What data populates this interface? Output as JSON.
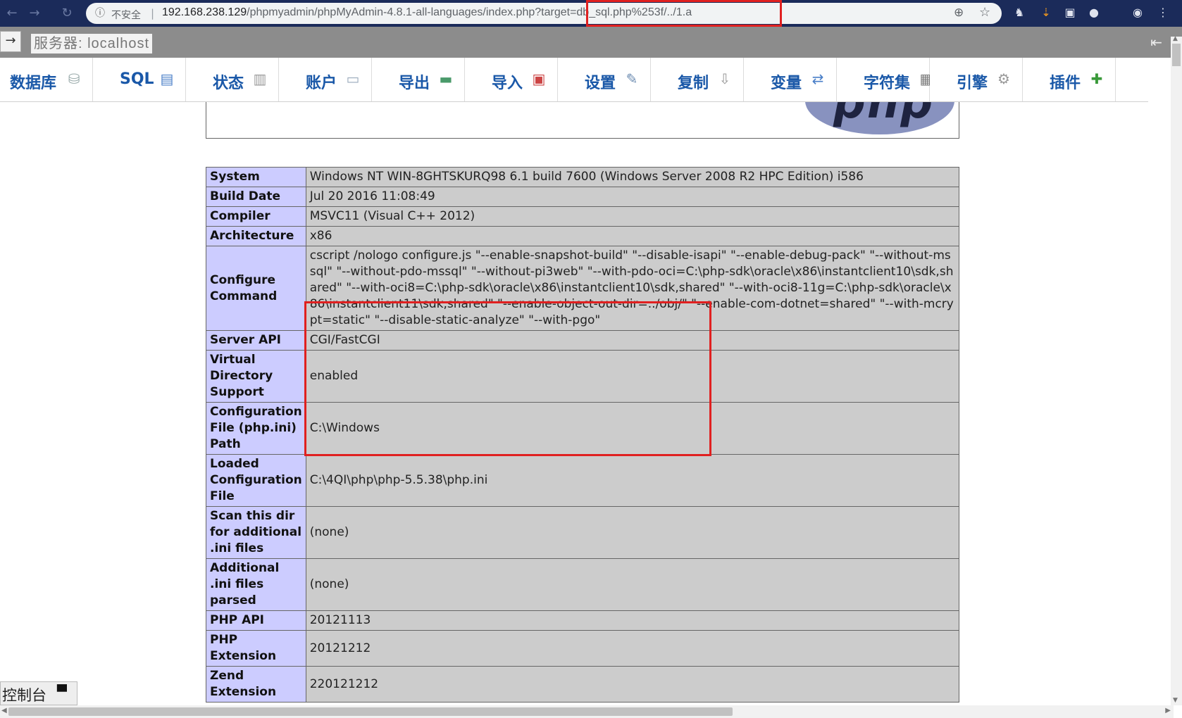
{
  "browser": {
    "insecure_label": "不安全",
    "separator": "|",
    "url_host": "192.168.238.129",
    "url_path": "/phpmyadmin/phpMyAdmin-4.8.1-all-languages/index.php",
    "url_query": "?target=db_sql.php%253f/../1.a",
    "highlight_color": "#e02020"
  },
  "server_bar": {
    "label": "服务器: localhost",
    "back_arrow": "→",
    "collapse_icon": "⇤"
  },
  "tabs": [
    {
      "label": "数据库",
      "icon": "database-icon"
    },
    {
      "label": "SQL",
      "icon": "sql-icon"
    },
    {
      "label": "状态",
      "icon": "status-icon"
    },
    {
      "label": "账户",
      "icon": "accounts-icon"
    },
    {
      "label": "导出",
      "icon": "export-icon"
    },
    {
      "label": "导入",
      "icon": "import-icon"
    },
    {
      "label": "设置",
      "icon": "wrench-icon"
    },
    {
      "label": "复制",
      "icon": "replication-icon"
    },
    {
      "label": "变量",
      "icon": "variables-icon"
    },
    {
      "label": "字符集",
      "icon": "charset-icon"
    },
    {
      "label": "引擎",
      "icon": "engine-icon"
    },
    {
      "label": "插件",
      "icon": "puzzle-icon"
    }
  ],
  "phpinfo": {
    "logo_text": "php",
    "rows": [
      {
        "key": "System",
        "value": "Windows NT WIN-8GHTSKURQ98 6.1 build 7600 (Windows Server 2008 R2 HPC Edition) i586"
      },
      {
        "key": "Build Date",
        "value": "Jul 20 2016 11:08:49"
      },
      {
        "key": "Compiler",
        "value": "MSVC11 (Visual C++ 2012)"
      },
      {
        "key": "Architecture",
        "value": "x86"
      },
      {
        "key": "Configure Command",
        "value": "cscript /nologo configure.js \"--enable-snapshot-build\" \"--disable-isapi\" \"--enable-debug-pack\" \"--without-mssql\" \"--without-pdo-mssql\" \"--without-pi3web\" \"--with-pdo-oci=C:\\php-sdk\\oracle\\x86\\instantclient10\\sdk,shared\" \"--with-oci8=C:\\php-sdk\\oracle\\x86\\instantclient10\\sdk,shared\" \"--with-oci8-11g=C:\\php-sdk\\oracle\\x86\\instantclient11\\sdk,shared\" \"--enable-object-out-dir=../obj/\" \"--enable-com-dotnet=shared\" \"--with-mcrypt=static\" \"--disable-static-analyze\" \"--with-pgo\""
      },
      {
        "key": "Server API",
        "value": "CGI/FastCGI"
      },
      {
        "key": "Virtual Directory Support",
        "value": "enabled"
      },
      {
        "key": "Configuration File (php.ini) Path",
        "value": "C:\\Windows"
      },
      {
        "key": "Loaded Configuration File",
        "value": "C:\\4QI\\php\\php-5.5.38\\php.ini"
      },
      {
        "key": "Scan this dir for additional .ini files",
        "value": "(none)"
      },
      {
        "key": "Additional .ini files parsed",
        "value": "(none)"
      },
      {
        "key": "PHP API",
        "value": "20121113"
      },
      {
        "key": "PHP Extension",
        "value": "20121212"
      },
      {
        "key": "Zend Extension",
        "value": "220121212"
      }
    ]
  },
  "console": {
    "label": "控制台"
  }
}
